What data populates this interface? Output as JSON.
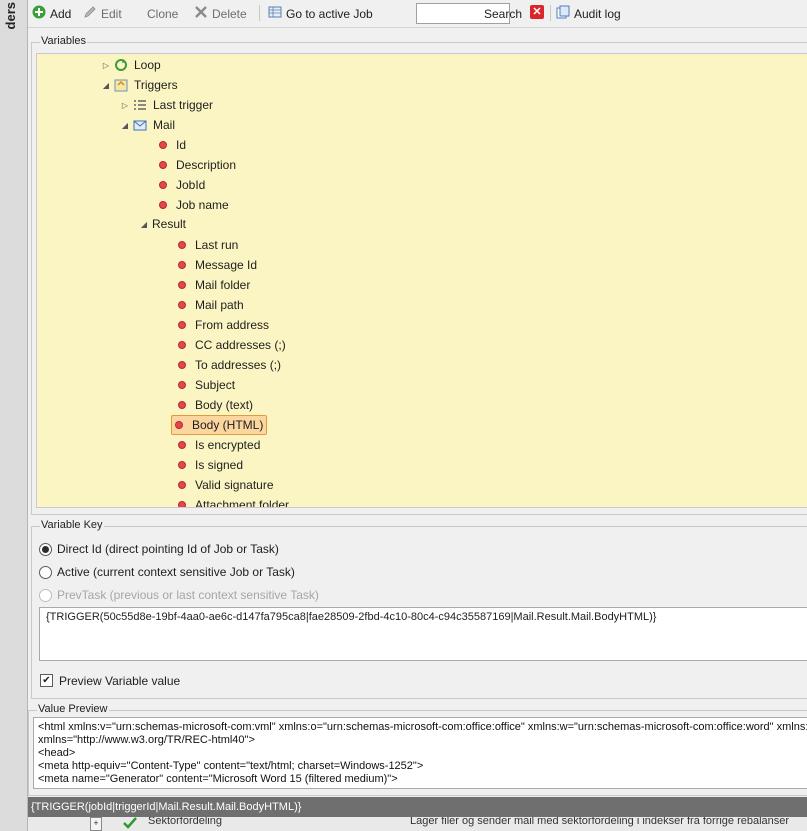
{
  "side_panel": {
    "label": "ders"
  },
  "toolbar": {
    "add": "Add",
    "edit": "Edit",
    "clone": "Clone",
    "delete": "Delete",
    "goto": "Go to active Job",
    "search_value": "",
    "search": "Search",
    "audit": "Audit log"
  },
  "variables": {
    "title": "Variables",
    "loop": "Loop",
    "triggers": "Triggers",
    "last_trigger": "Last trigger",
    "mail": "Mail",
    "mail_fields": [
      "Id",
      "Description",
      "JobId",
      "Job name"
    ],
    "result": "Result",
    "result_fields": [
      "Last run",
      "Message Id",
      "Mail folder",
      "Mail path",
      "From address",
      "CC addresses (;)",
      "To addresses (;)",
      "Subject",
      "Body (text)",
      "Body (HTML)",
      "Is encrypted",
      "Is signed",
      "Valid signature",
      "Attachment folder"
    ],
    "selected": "Body (HTML)"
  },
  "variable_key": {
    "title": "Variable Key",
    "direct": "Direct Id (direct pointing Id of Job or Task)",
    "active": "Active (current context sensitive Job or Task)",
    "prevtask": "PrevTask (previous or last context sensitive Task)",
    "selected_option": "direct",
    "value": "{TRIGGER(50c55d8e-19bf-4aa0-ae6c-d147fa795ca8|fae28509-2fbd-4c10-80c4-c94c35587169|Mail.Result.Mail.BodyHTML)}",
    "preview_label": "Preview Variable value",
    "preview_checked": true
  },
  "value_preview": {
    "title": "Value Preview",
    "lines": [
      "<html xmlns:v=\"urn:schemas-microsoft-com:vml\" xmlns:o=\"urn:schemas-microsoft-com:office:office\" xmlns:w=\"urn:schemas-microsoft-com:office:word\" xmlns:",
      "xmlns=\"http://www.w3.org/TR/REC-html40\">",
      "<head>",
      "<meta http-equiv=\"Content-Type\" content=\"text/html; charset=Windows-1252\">",
      "<meta name=\"Generator\" content=\"Microsoft Word 15 (filtered medium)\">"
    ]
  },
  "status": {
    "text": "{TRIGGER(jobId|triggerId|Mail.Result.Mail.BodyHTML)}"
  },
  "background_row": {
    "name": "Sektorfordeling",
    "description": "Lager filer og sender mail med sektorfordeling i indekser fra forrige rebalanser"
  }
}
